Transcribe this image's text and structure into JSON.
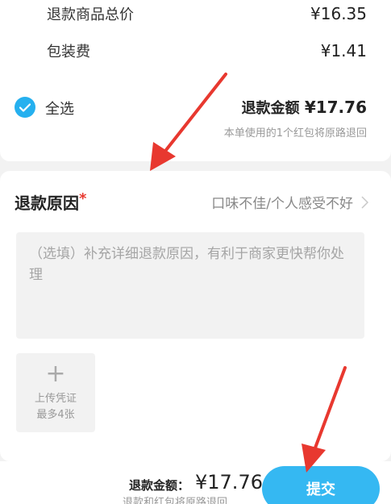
{
  "summary": {
    "goods_total_label": "退款商品总价",
    "goods_total_value": "¥16.35",
    "packing_fee_label": "包装费",
    "packing_fee_value": "¥1.41",
    "select_all_label": "全选",
    "select_all_checked": true,
    "refund_amount_label": "退款金额",
    "refund_amount_value": "¥17.76",
    "refund_note": "本单使用的1个红包将原路退回"
  },
  "reason": {
    "title": "退款原因",
    "required_mark": "*",
    "selected": "口味不佳/个人感受不好",
    "chevron_icon": "chevron-right-icon"
  },
  "details": {
    "placeholder": "（选填）补充详细退款原因，有利于商家更快帮你处理"
  },
  "upload": {
    "plus_icon": "plus-icon",
    "label_line1": "上传凭证",
    "label_line2": "最多4张"
  },
  "footer": {
    "amount_label": "退款金额：",
    "amount_value": "¥17.76",
    "note": "退款和红包将原路退回",
    "submit_label": "提交"
  },
  "colors": {
    "accent": "#35b8f2",
    "check": "#25b0ef",
    "required": "#e8382f",
    "annotation_arrow": "#e8382f"
  }
}
